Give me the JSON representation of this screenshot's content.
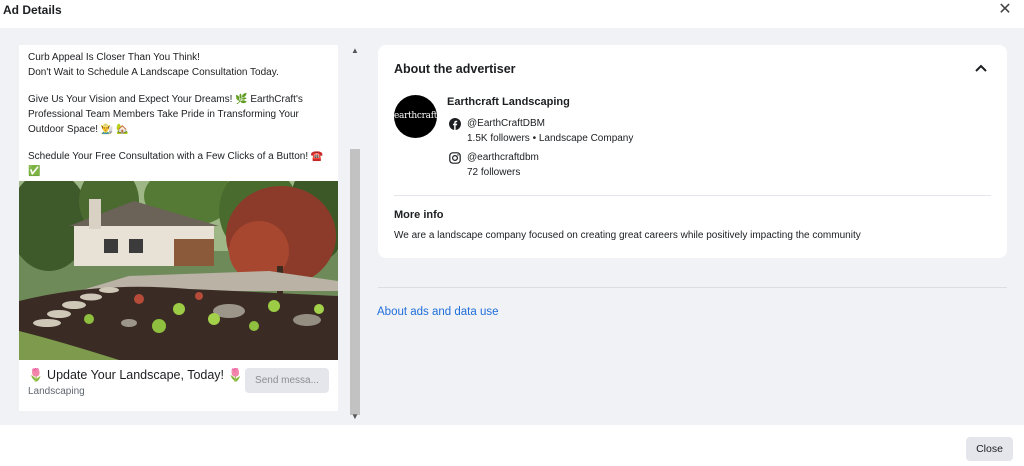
{
  "header": {
    "title": "Ad Details",
    "close_icon": "close-icon"
  },
  "ad": {
    "lines": [
      "Curb Appeal Is Closer Than You Think!",
      "Don't Wait to Schedule A Landscape Consultation Today.",
      "Give Us Your Vision and Expect Your Dreams! 🌿 EarthCraft's",
      "Professional Team Members Take Pride in Transforming Your",
      "Outdoor Space! 👨‍🌾 🏡",
      "Schedule Your Free Consultation with a Few Clicks of a Button! ☎️",
      "✅"
    ],
    "headline": "🌷 Update Your Landscape, Today! 🌷",
    "subtitle": "Landscaping",
    "cta_label": "Send messa..."
  },
  "advertiser": {
    "section_title": "About the advertiser",
    "logo_text": "earthcraft",
    "name": "Earthcraft Landscaping",
    "facebook": {
      "handle": "@EarthCraftDBM",
      "meta": "1.5K followers • Landscape Company"
    },
    "instagram": {
      "handle": "@earthcraftdbm",
      "meta": "72 followers"
    },
    "more_info_title": "More info",
    "more_info_text": "We are a landscape company focused on creating great careers while positively impacting the community"
  },
  "links": {
    "ads_data": "About ads and data use"
  },
  "footer": {
    "close_label": "Close"
  },
  "colors": {
    "link": "#216fdb",
    "background": "#f0f2f5",
    "button": "#e4e6eb"
  }
}
